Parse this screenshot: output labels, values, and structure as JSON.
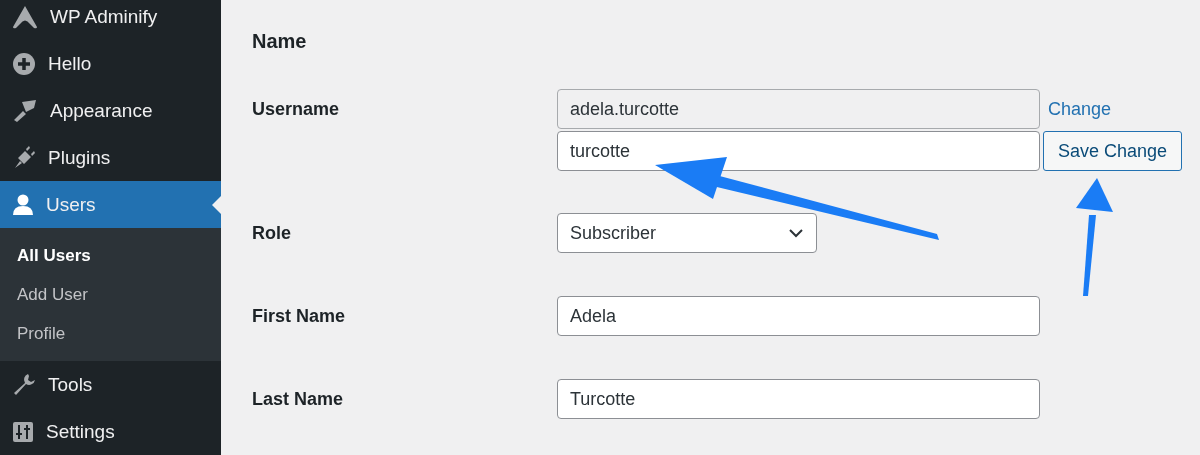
{
  "sidebar": {
    "items": [
      {
        "label": "WP Adminify",
        "selected": false
      },
      {
        "label": "Hello",
        "selected": false
      },
      {
        "label": "Appearance",
        "selected": false
      },
      {
        "label": "Plugins",
        "selected": false
      },
      {
        "label": "Users",
        "selected": true,
        "children": [
          {
            "label": "All Users",
            "selected": true
          },
          {
            "label": "Add User",
            "selected": false
          },
          {
            "label": "Profile",
            "selected": false
          }
        ]
      },
      {
        "label": "Tools",
        "selected": false
      },
      {
        "label": "Settings",
        "selected": false
      }
    ]
  },
  "form": {
    "heading": "Name",
    "rows": [
      {
        "label": "Username",
        "kind": "username",
        "value": "adela.turcotte",
        "disabled": true,
        "link": "Change",
        "new_value": "turcotte",
        "button": "Save Change"
      },
      {
        "label": "Role",
        "kind": "select",
        "value": "Subscriber"
      },
      {
        "label": "First Name",
        "kind": "text",
        "value": "Adela"
      },
      {
        "label": "Last Name",
        "kind": "text",
        "value": "Turcotte"
      }
    ]
  }
}
